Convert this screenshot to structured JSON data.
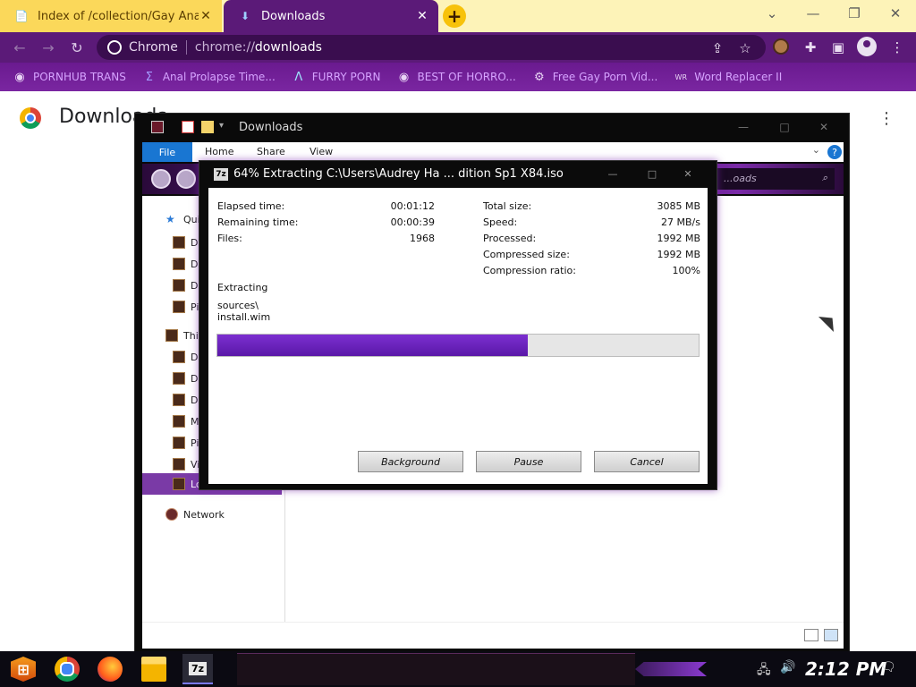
{
  "browser": {
    "tabs": [
      {
        "title": "Index of /collection/Gay Anal R",
        "icon": "page-icon"
      },
      {
        "title": "Downloads",
        "icon": "download-icon"
      }
    ],
    "new_tab_label": "+",
    "window_controls": {
      "minimize": "—",
      "restore": "❐",
      "close": "✕",
      "tab_search": "⌄"
    },
    "omnibox": {
      "chip": "Chrome",
      "url_scheme": "chrome://",
      "url_rest": "downloads"
    },
    "bookmarks": [
      {
        "label": "PORNHUB TRANS",
        "icon": "globe-icon"
      },
      {
        "label": "Anal Prolapse Time...",
        "icon": "sigma-icon"
      },
      {
        "label": "FURRY PORN",
        "icon": "lambda-icon"
      },
      {
        "label": "BEST OF HORRO...",
        "icon": "globe-icon"
      },
      {
        "label": "Free Gay Porn Vid...",
        "icon": "gear-icon"
      },
      {
        "label": "Word Replacer II",
        "icon": "wr-icon"
      }
    ],
    "colors": {
      "theme": "#5b1a78",
      "bookmark_text": "#d6a3ff",
      "tab_inactive": "#fbd85a"
    }
  },
  "downloads_page": {
    "title": "Downloads",
    "menu": "⋮"
  },
  "explorer": {
    "title": "Downloads",
    "ribbon_tabs": {
      "file": "File",
      "home": "Home",
      "share": "Share",
      "view": "View",
      "help": "?"
    },
    "search_placeholder": "...oads",
    "nav": {
      "quick_access": "Qui",
      "quick_items": [
        "De",
        "Do",
        "Do",
        "Pi"
      ],
      "this_pc": "Thi",
      "pc_items": [
        "De",
        "Do",
        "Do",
        "M",
        "Pi",
        "Vi",
        "Lo"
      ],
      "network": "Network"
    }
  },
  "sevenzip": {
    "title": "64% Extracting C:\\Users\\Audrey Ha ... dition Sp1 X84.iso",
    "window_controls": {
      "minimize": "—",
      "maximize": "□",
      "close": "✕"
    },
    "left_stats": [
      {
        "label": "Elapsed time:",
        "value": "00:01:12"
      },
      {
        "label": "Remaining time:",
        "value": "00:00:39"
      },
      {
        "label": "Files:",
        "value": "1968"
      }
    ],
    "right_stats": [
      {
        "label": "Total size:",
        "value": "3085 MB"
      },
      {
        "label": "Speed:",
        "value": "27 MB/s"
      },
      {
        "label": "Processed:",
        "value": "1992 MB"
      },
      {
        "label": "Compressed size:",
        "value": "1992 MB"
      },
      {
        "label": "Compression ratio:",
        "value": "100%"
      }
    ],
    "operation": "Extracting",
    "current_path": "sources\\",
    "current_file": "install.wim",
    "progress": 0.645,
    "progress_color": "#6a22bd",
    "buttons": {
      "background": "Background",
      "pause": "Pause",
      "cancel": "Cancel"
    }
  },
  "taskbar": {
    "apps": [
      "start-icon",
      "chrome-icon",
      "firefox-icon",
      "file-explorer-icon",
      "7zip-icon"
    ],
    "sevenzip_label": "7z",
    "clock": "2:12 PM",
    "tray": {
      "network": "🖧",
      "volume": "🔊",
      "notifications": "🗨"
    }
  }
}
